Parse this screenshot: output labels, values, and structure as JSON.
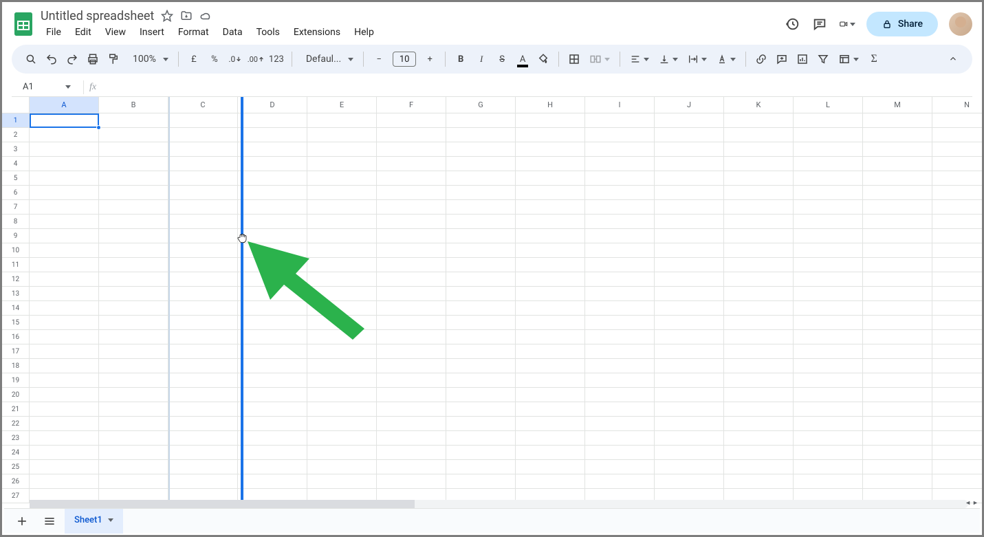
{
  "header": {
    "doc_title": "Untitled spreadsheet",
    "menus": [
      "File",
      "Edit",
      "View",
      "Insert",
      "Format",
      "Data",
      "Tools",
      "Extensions",
      "Help"
    ],
    "share_label": "Share"
  },
  "toolbar": {
    "zoom": "100%",
    "currency_symbol": "£",
    "percent_symbol": "%",
    "decimal_dec": ".0",
    "decimal_inc": ".00",
    "num_format": "123",
    "font_name": "Defaul...",
    "font_size": "10"
  },
  "name_box": {
    "value": "A1"
  },
  "grid": {
    "columns": [
      "A",
      "B",
      "C",
      "D",
      "E",
      "F",
      "G",
      "H",
      "I",
      "J",
      "K",
      "L",
      "M",
      "N"
    ],
    "rows": [
      1,
      2,
      3,
      4,
      5,
      6,
      7,
      8,
      9,
      10,
      11,
      12,
      13,
      14,
      15,
      16,
      17,
      18,
      19,
      20,
      21,
      22,
      23,
      24,
      25,
      26,
      27
    ],
    "selected_col": "A",
    "selected_row": 1
  },
  "sheet_tabs": {
    "active": "Sheet1",
    "tabs": [
      "Sheet1"
    ]
  }
}
